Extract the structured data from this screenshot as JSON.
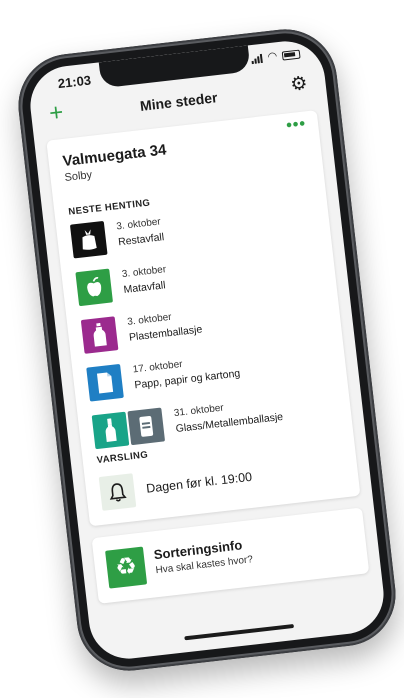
{
  "statusbar": {
    "time": "21:03"
  },
  "navbar": {
    "title": "Mine steder"
  },
  "location": {
    "address": "Valmuegata 34",
    "district": "Solby"
  },
  "next_pickup": {
    "heading": "NESTE HENTING",
    "items": [
      {
        "date": "3. oktober",
        "kind": "Restavfall",
        "icon": "restavfall-bag-icon",
        "color": "#111111"
      },
      {
        "date": "3. oktober",
        "kind": "Matavfall",
        "icon": "matavfall-apple-icon",
        "color": "#2e9e45"
      },
      {
        "date": "3. oktober",
        "kind": "Plastemballasje",
        "icon": "plast-bottle-icon",
        "color": "#9b2a8e"
      },
      {
        "date": "17. oktober",
        "kind": "Papp, papir og kartong",
        "icon": "papir-sheet-icon",
        "color": "#1f7fc4"
      },
      {
        "date": "31. oktober",
        "kind": "Glass/Metallemballasje",
        "icon": "glass-metall-icon",
        "colors": [
          "#19a488",
          "#5c6c75"
        ]
      }
    ]
  },
  "alerts": {
    "heading": "VARSLING",
    "text": "Dagen før kl. 19:00"
  },
  "sorting_info": {
    "title": "Sorteringsinfo",
    "subtitle": "Hva skal kastes hvor?"
  },
  "colors": {
    "accent": "#2e9e45",
    "background": "#f3f3f3",
    "card": "#ffffff"
  }
}
